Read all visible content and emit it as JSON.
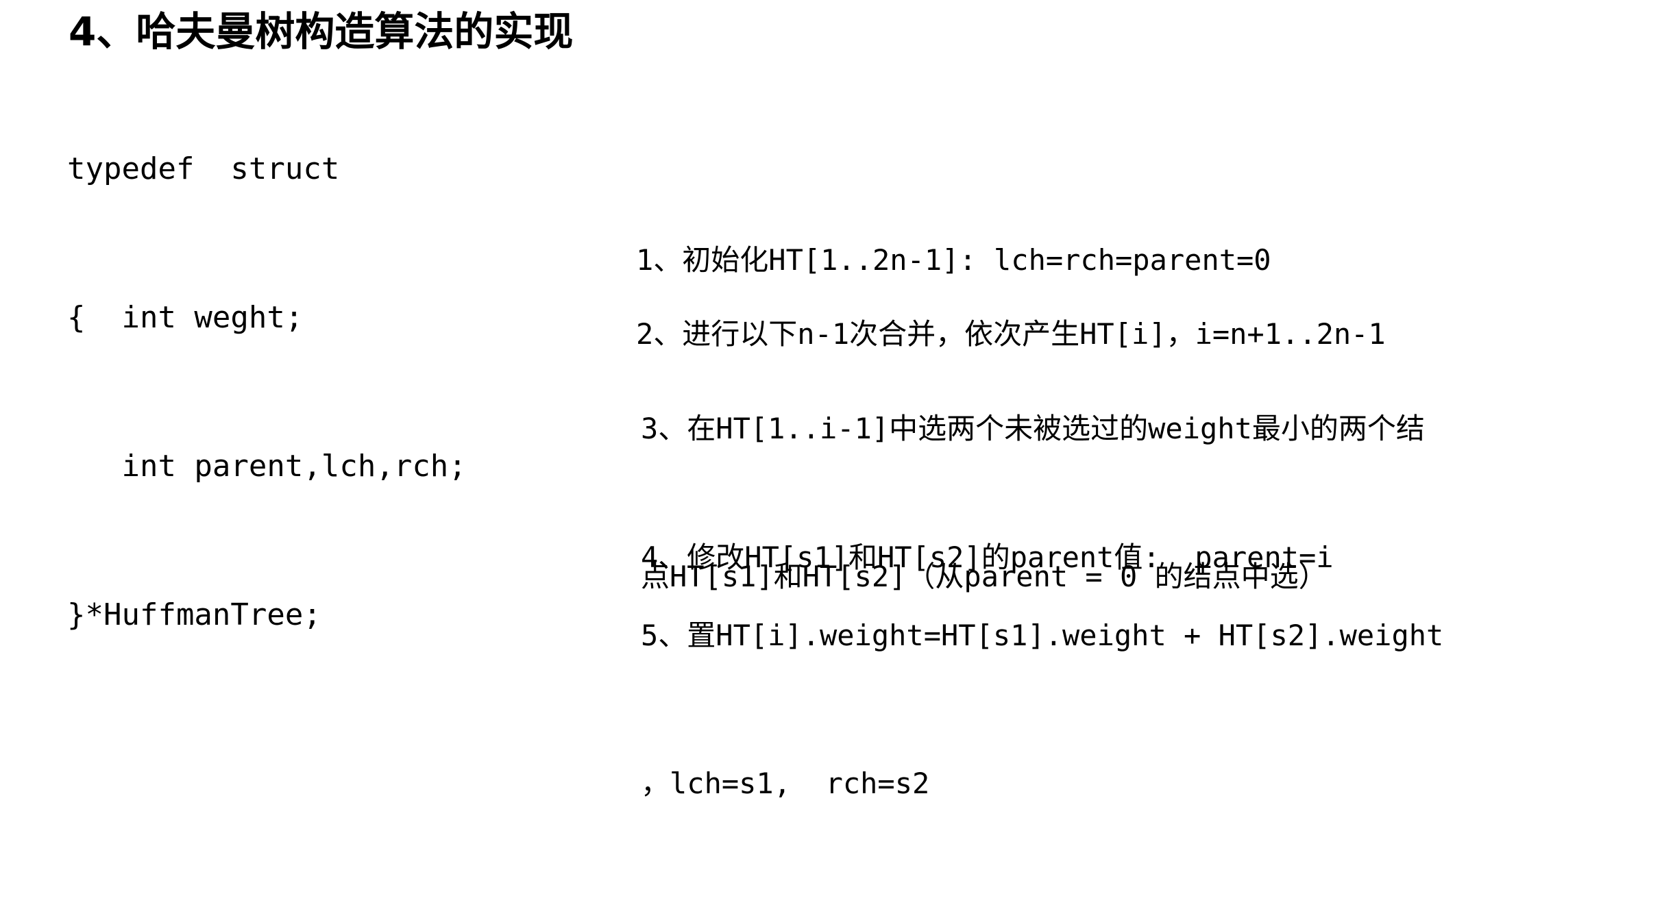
{
  "title": "4、哈夫曼树构造算法的实现",
  "code": [
    "typedef  struct",
    "{  int weght;",
    "   int parent,lch,rch;",
    "}*HuffmanTree;"
  ],
  "steps": [
    {
      "lines": [
        "1、初始化HT[1..2n-1]: lch=rch=parent=0"
      ]
    },
    {
      "lines": [
        "2、进行以下n-1次合并，依次产生HT[i]，i=n+1..2n-1"
      ]
    },
    {
      "lines": [
        "3、在HT[1..i-1]中选两个未被选过的weight最小的两个结",
        "点HT[s1]和HT[s2]（从parent = 0 的结点中选）"
      ]
    },
    {
      "lines": [
        "4、修改HT[s1]和HT[s2]的parent值:  parent=i"
      ]
    },
    {
      "lines": [
        "5、置HT[i].weight=HT[s1].weight + HT[s2].weight",
        "，lch=s1,  rch=s2"
      ]
    }
  ]
}
